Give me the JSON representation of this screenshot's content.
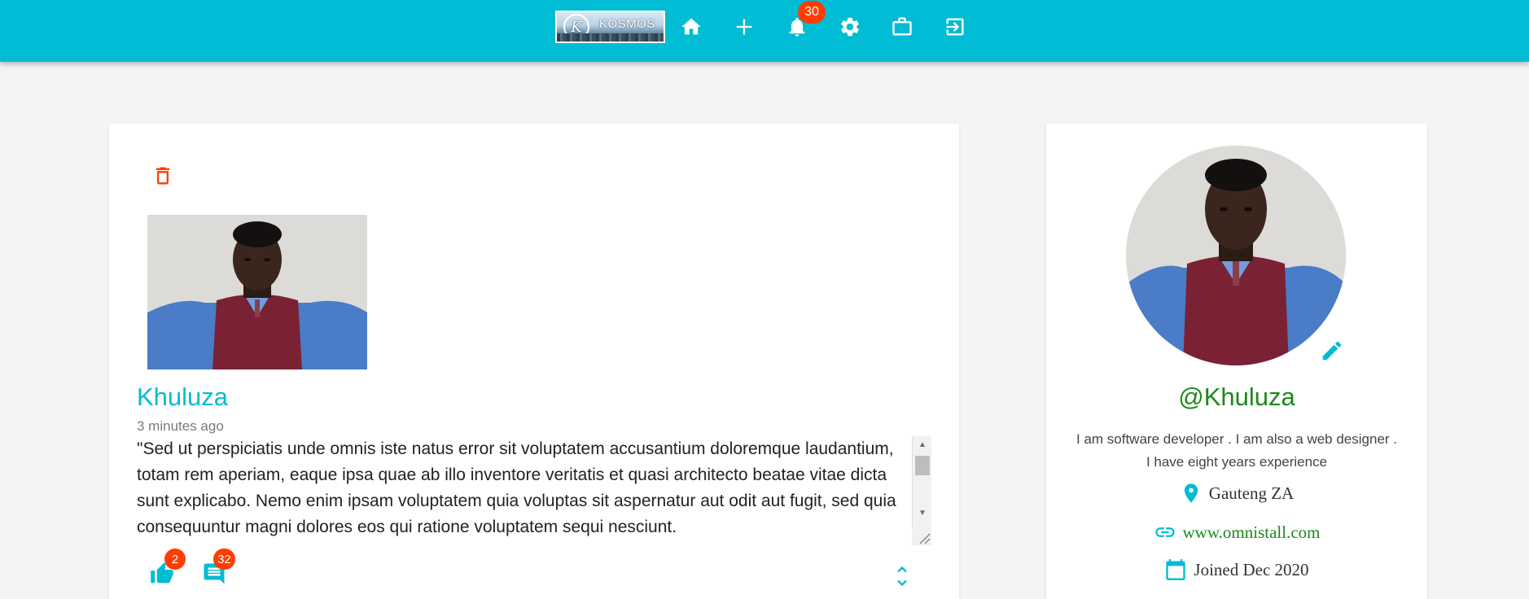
{
  "header": {
    "logo_text": "KOSMOS",
    "logo_letter": "K",
    "notifications_count": "30",
    "icons": [
      "home-icon",
      "add-icon",
      "bell-icon",
      "gear-icon",
      "briefcase-icon",
      "logout-icon"
    ]
  },
  "post": {
    "author": "Khuluza",
    "time_ago": "3 minutes ago",
    "body": "\"Sed ut perspiciatis unde omnis iste natus error sit voluptatem accusantium doloremque laudantium, totam rem aperiam, eaque ipsa quae ab illo inventore veritatis et quasi architecto beatae vitae dicta sunt explicabo. Nemo enim ipsam voluptatem quia voluptas sit aspernatur aut odit aut fugit, sed quia consequuntur magni dolores eos qui ratione voluptatem sequi nesciunt.",
    "likes_count": "2",
    "comments_count": "32"
  },
  "profile": {
    "handle": "@Khuluza",
    "bio": "I am software developer . I am also a web designer . I have eight years experience",
    "location": "Gauteng ZA",
    "website": "www.omnistall.com",
    "joined": "Joined Dec 2020"
  },
  "colors": {
    "primary": "#00bcd4",
    "badge": "#ff3d00",
    "delete": "#ff3d00",
    "handle": "#1a8a1a",
    "background": "#f4f4f4"
  }
}
